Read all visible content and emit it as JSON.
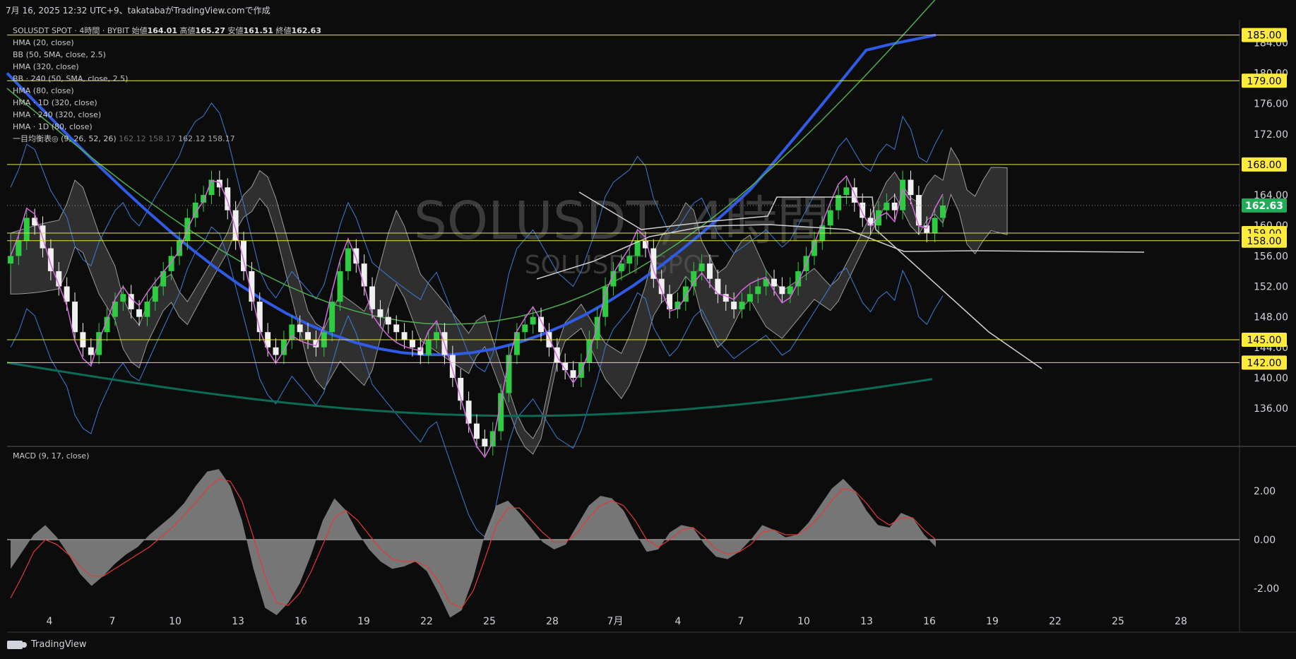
{
  "header": "7月 16, 2025 12:32 UTC+9、takatabaがTradingView.comで作成",
  "footer": {
    "brand": "TradingView",
    "logo_icon": "tradingview-logo-icon"
  },
  "watermark": {
    "title": "SOLUSDT, 4時間",
    "subtitle": "SOLUSDT SPOT"
  },
  "symbol_line": {
    "name": "SOLUSDT SPOT · 4時間 · BYBIT",
    "open_label": "始値",
    "open": "164.01",
    "high_label": "高値",
    "high": "165.27",
    "low_label": "安値",
    "low": "161.51",
    "close_label": "終値",
    "close": "162.63"
  },
  "indicators": [
    "HMA (20, close)",
    "BB (50, SMA, close, 2.5)",
    "HMA (320, close)",
    "BB · 240 (50, SMA, close, 2.5)",
    "HMA (80, close)",
    "HMA · 1D (320, close)",
    "HMA · 240 (320, close)",
    "HMA · 1D (80, close)"
  ],
  "ichimoku": {
    "label": "一目均衡表◎ (9, 26, 52, 26)",
    "values": [
      "162.12",
      "158.17",
      "162.12",
      "158.17"
    ]
  },
  "macd_label": "MACD (9, 17, close)",
  "colors": {
    "background": "#0c0c0c",
    "up": "#2ecc40",
    "down": "#f0f0f0",
    "hline": "#e6e64a",
    "price_tag": "#ffeb3b",
    "last_price_tag": "#22ab58",
    "hma20": "#d66adf",
    "bb": "#3b7dd8",
    "hma_blue": "#2f5be6",
    "hma_green": "#4caf50",
    "hma_teal": "#0b6b57",
    "ichimoku": "#cfcfcf",
    "macd_hist": "#8a8a8a",
    "macd_signal": "#e53935"
  },
  "chart_data": {
    "type": "candlestick",
    "title": "SOLUSDT SPOT · 4時間 · BYBIT",
    "x_ticks": [
      "4",
      "7",
      "10",
      "13",
      "16",
      "19",
      "22",
      "25",
      "28",
      "7月",
      "4",
      "7",
      "10",
      "13",
      "16",
      "19",
      "22",
      "25",
      "28"
    ],
    "y_ticks": [
      "184.00",
      "180.00",
      "176.00",
      "172.00",
      "164.00",
      "160.00",
      "156.00",
      "152.00",
      "148.00",
      "144.00",
      "140.00",
      "136.00"
    ],
    "ylim": [
      131,
      187
    ],
    "horizontal_levels": [
      185.0,
      179.0,
      168.0,
      159.0,
      158.0,
      145.0,
      142.0
    ],
    "level_labels": [
      "185.00",
      "179.00",
      "168.00",
      "159.00",
      "158.00",
      "145.00",
      "142.00"
    ],
    "last_price": 162.63,
    "last_price_label": "162.63",
    "close_series": [
      156,
      158,
      161,
      160,
      157,
      154,
      152,
      150,
      146,
      144,
      143,
      146,
      148,
      150,
      151,
      149,
      148,
      150,
      152,
      154,
      156,
      158,
      161,
      163,
      164,
      166,
      165,
      162,
      158,
      154,
      150,
      146,
      144,
      143,
      145,
      147,
      146,
      145,
      144,
      146,
      150,
      154,
      157,
      155,
      152,
      149,
      148,
      147,
      146,
      145,
      144,
      143,
      145,
      146,
      143,
      140,
      137,
      134,
      132,
      131,
      133,
      138,
      143,
      146,
      147,
      148,
      146,
      144,
      142,
      141,
      140,
      142,
      145,
      148,
      152,
      154,
      155,
      156,
      158,
      157,
      153,
      151,
      149,
      150,
      152,
      154,
      155,
      153,
      151,
      150,
      149,
      150,
      151,
      152,
      153,
      152,
      151,
      152,
      154,
      156,
      158,
      160,
      162,
      164,
      165,
      163,
      161,
      160,
      162,
      163,
      162,
      166,
      164,
      160,
      159,
      161,
      162.63
    ],
    "macd": {
      "ylim": [
        -3.8,
        3.6
      ],
      "y_ticks": [
        "2.00",
        "0.00",
        "-2.00"
      ],
      "x_ticks": [
        "4",
        "7",
        "10",
        "13",
        "16",
        "19",
        "22",
        "25",
        "28",
        "7月",
        "4",
        "7",
        "10",
        "13",
        "16",
        "19",
        "22",
        "25",
        "28"
      ],
      "histogram": [
        -1.2,
        -0.5,
        0.2,
        0.6,
        0.1,
        -0.6,
        -1.4,
        -1.9,
        -1.5,
        -1.0,
        -0.6,
        -0.3,
        0.2,
        0.6,
        1.0,
        1.5,
        2.2,
        2.8,
        2.9,
        2.2,
        0.8,
        -1.2,
        -2.8,
        -3.1,
        -2.6,
        -1.8,
        -0.6,
        0.8,
        1.7,
        1.2,
        0.3,
        -0.4,
        -0.9,
        -1.2,
        -1.1,
        -0.9,
        -1.3,
        -2.2,
        -3.2,
        -2.9,
        -1.6,
        0.2,
        1.4,
        1.6,
        1.1,
        0.5,
        -0.1,
        -0.4,
        -0.2,
        0.6,
        1.4,
        1.8,
        1.7,
        1.2,
        0.3,
        -0.5,
        -0.4,
        0.3,
        0.6,
        0.5,
        -0.2,
        -0.7,
        -0.8,
        -0.5,
        0.0,
        0.6,
        0.4,
        0.1,
        0.2,
        0.7,
        1.4,
        2.1,
        2.5,
        2.0,
        1.2,
        0.6,
        0.5,
        1.1,
        0.9,
        0.2,
        -0.3
      ],
      "signal": [
        -2.4,
        -1.5,
        -0.5,
        0.0,
        -0.2,
        -0.6,
        -1.1,
        -1.5,
        -1.5,
        -1.2,
        -0.9,
        -0.6,
        -0.3,
        0.1,
        0.5,
        1.0,
        1.5,
        2.1,
        2.5,
        2.4,
        1.6,
        0.1,
        -1.5,
        -2.6,
        -2.7,
        -2.2,
        -1.3,
        -0.2,
        0.9,
        1.2,
        0.8,
        0.2,
        -0.4,
        -0.8,
        -0.9,
        -0.9,
        -1.1,
        -1.7,
        -2.6,
        -2.8,
        -2.1,
        -0.8,
        0.6,
        1.3,
        1.3,
        0.8,
        0.3,
        -0.1,
        -0.1,
        0.3,
        0.9,
        1.4,
        1.6,
        1.4,
        0.8,
        0.0,
        -0.3,
        0.0,
        0.4,
        0.5,
        0.1,
        -0.4,
        -0.6,
        -0.5,
        -0.2,
        0.3,
        0.4,
        0.2,
        0.2,
        0.5,
        1.0,
        1.6,
        2.1,
        2.0,
        1.5,
        0.9,
        0.6,
        0.9,
        0.9,
        0.4,
        0.0
      ]
    }
  }
}
